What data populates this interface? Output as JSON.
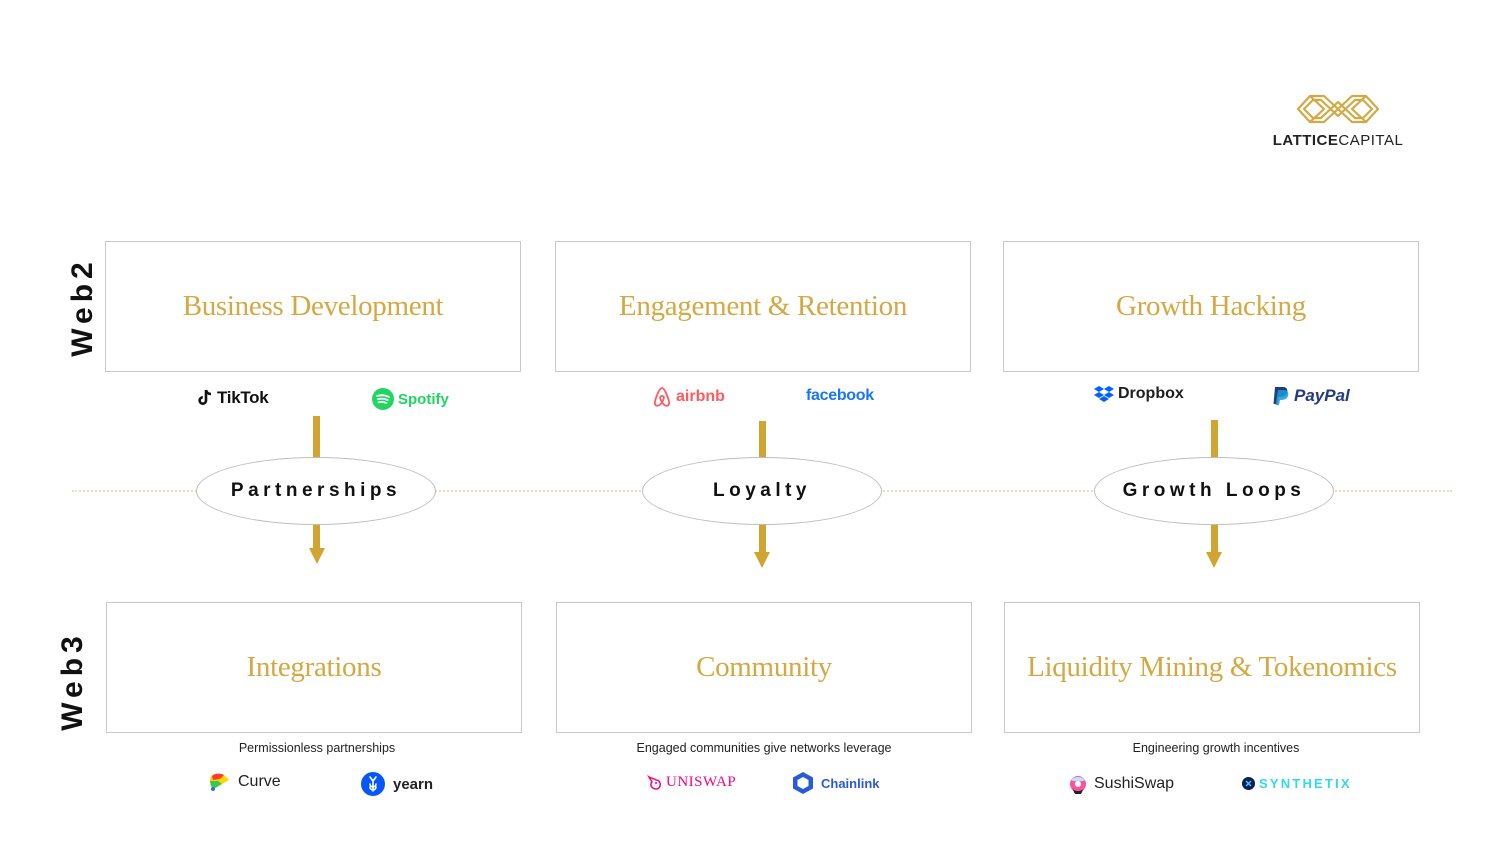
{
  "brand": {
    "name_bold": "LATTICE",
    "name_regular": "CAPITAL",
    "color": "#d4a843"
  },
  "rows": {
    "web2_label": "Web2",
    "web3_label": "Web3"
  },
  "colors": {
    "gold": "#d4a843",
    "arrow": "#d2a532",
    "box_border": "#c9c9c9",
    "divider": "#f2dcae"
  },
  "columns": [
    {
      "web2_title": "Business Development",
      "web2_logos": [
        {
          "name": "TikTok",
          "icon": "tiktok-icon",
          "color": "#111111"
        },
        {
          "name": "Spotify",
          "icon": "spotify-icon",
          "color": "#1ed760"
        }
      ],
      "bridge": "Partnerships",
      "web3_title": "Integrations",
      "caption": "Permissionless partnerships",
      "web3_logos": [
        {
          "name": "Curve",
          "icon": "curve-icon",
          "color": "#222222"
        },
        {
          "name": "yearn",
          "icon": "yearn-icon",
          "color": "#222222"
        }
      ]
    },
    {
      "web2_title": "Engagement & Retention",
      "web2_logos": [
        {
          "name": "airbnb",
          "icon": "airbnb-icon",
          "color": "#ff5a5f"
        },
        {
          "name": "facebook",
          "icon": "facebook-icon",
          "color": "#1877f2"
        }
      ],
      "bridge": "Loyalty",
      "web3_title": "Community",
      "caption": "Engaged communities give networks leverage",
      "web3_logos": [
        {
          "name": "UNISWAP",
          "icon": "uniswap-icon",
          "color": "#ff007a"
        },
        {
          "name": "Chainlink",
          "icon": "chainlink-icon",
          "color": "#2a5ada"
        }
      ]
    },
    {
      "web2_title": "Growth Hacking",
      "web2_logos": [
        {
          "name": "Dropbox",
          "icon": "dropbox-icon",
          "color": "#0061ff"
        },
        {
          "name": "PayPal",
          "icon": "paypal-icon",
          "color": "#253b80"
        }
      ],
      "bridge": "Growth Loops",
      "web3_title": "Liquidity Mining & Tokenomics",
      "caption": "Engineering growth incentives",
      "web3_logos": [
        {
          "name": "SushiSwap",
          "icon": "sushiswap-icon",
          "color": "#222222"
        },
        {
          "name": "SYNTHETIX",
          "icon": "synthetix-icon",
          "color": "#31d8f0"
        }
      ]
    }
  ]
}
